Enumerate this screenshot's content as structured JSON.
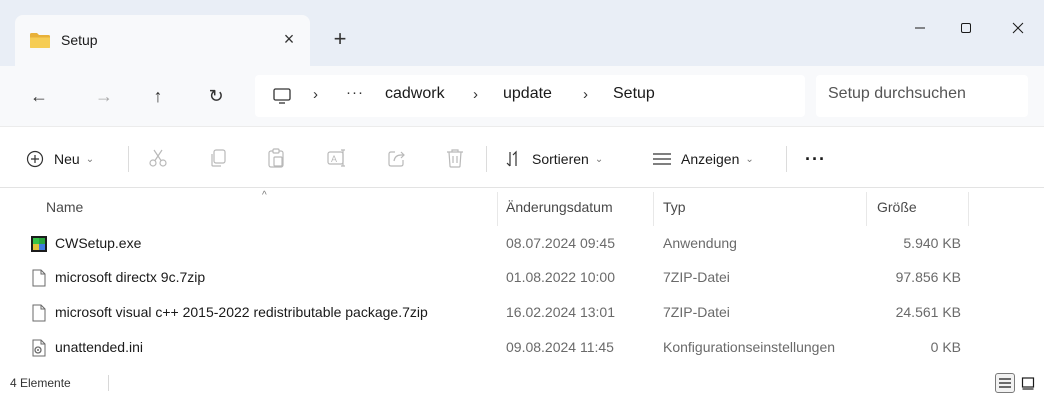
{
  "tab": {
    "title": "Setup",
    "close_glyph": "×",
    "new_tab_glyph": "+",
    "icon": "folder-icon"
  },
  "window_controls": {
    "minimize": "—",
    "maximize": "☐",
    "close": "✕"
  },
  "nav": {
    "back": "←",
    "forward": "→",
    "up": "↑",
    "refresh": "↻"
  },
  "breadcrumb": {
    "separator": "›",
    "overflow": "···",
    "items": [
      "cadwork",
      "update",
      "Setup"
    ]
  },
  "search": {
    "placeholder": "Setup durchsuchen"
  },
  "commandbar": {
    "new_label": "Neu",
    "sort_label": "Sortieren",
    "view_label": "Anzeigen",
    "more_label": "···",
    "chevron": "⌄"
  },
  "columns": {
    "name": "Name",
    "date": "Änderungsdatum",
    "type": "Typ",
    "size": "Größe",
    "sort_caret": "^"
  },
  "files": [
    {
      "name": "CWSetup.exe",
      "date": "08.07.2024 09:45",
      "type": "Anwendung",
      "size": "5.940 KB",
      "icon": "exe-app-icon"
    },
    {
      "name": "microsoft directx 9c.7zip",
      "date": "01.08.2022 10:00",
      "type": "7ZIP-Datei",
      "size": "97.856 KB",
      "icon": "file-icon"
    },
    {
      "name": "microsoft visual c++ 2015-2022 redistributable package.7zip",
      "date": "16.02.2024 13:01",
      "type": "7ZIP-Datei",
      "size": "24.561 KB",
      "icon": "file-icon"
    },
    {
      "name": "unattended.ini",
      "date": "09.08.2024 11:45",
      "type": "Konfigurationseinstellungen",
      "size": "0 KB",
      "icon": "settings-file-icon"
    }
  ],
  "status": {
    "item_count": "4 Elemente"
  },
  "colors": {
    "titlebar_bg": "#e9eef6",
    "tab_bg": "#f8f9fb",
    "folder_yellow": "#f4c542",
    "accent_blue": "#2a6fd6"
  }
}
